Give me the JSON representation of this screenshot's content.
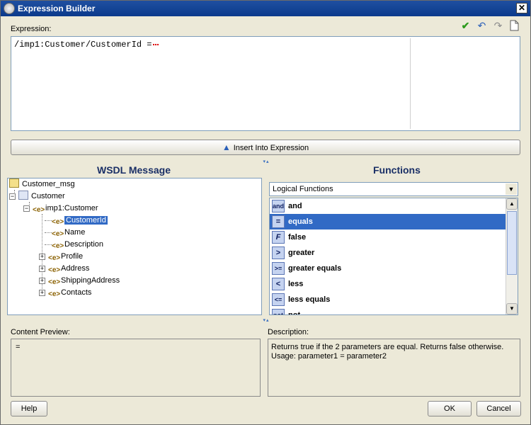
{
  "window": {
    "title": "Expression Builder",
    "close_label": "✕"
  },
  "expression": {
    "label": "Expression:",
    "value": "/imp1:Customer/CustomerId ="
  },
  "toolbar": {
    "icons": [
      "checkmark-icon",
      "undo-icon",
      "redo-icon",
      "new-document-icon"
    ]
  },
  "insert_button": {
    "label": "Insert Into Expression"
  },
  "wsdl": {
    "title": "WSDL Message",
    "tree": [
      {
        "label": "Customer_msg"
      },
      {
        "label": "Customer"
      },
      {
        "label": "imp1:Customer"
      },
      {
        "label": "CustomerId",
        "selected": true
      },
      {
        "label": "Name"
      },
      {
        "label": "Description"
      },
      {
        "label": "Profile"
      },
      {
        "label": "Address"
      },
      {
        "label": "ShippingAddress"
      },
      {
        "label": "Contacts"
      }
    ]
  },
  "functions": {
    "title": "Functions",
    "category": "Logical Functions",
    "items": [
      {
        "icon": "and",
        "label": "and"
      },
      {
        "icon": "=",
        "label": "equals",
        "selected": true
      },
      {
        "icon": "F",
        "label": "false"
      },
      {
        "icon": ">",
        "label": "greater"
      },
      {
        "icon": ">=",
        "label": "greater equals"
      },
      {
        "icon": "<",
        "label": "less"
      },
      {
        "icon": "<=",
        "label": "less equals"
      },
      {
        "icon": "not",
        "label": "not"
      }
    ]
  },
  "content_preview": {
    "label": "Content Preview:",
    "value": "="
  },
  "description": {
    "label": "Description:",
    "line1": "Returns true if the 2 parameters are equal. Returns false otherwise.",
    "line2": "Usage: parameter1 = parameter2"
  },
  "buttons": {
    "help": "Help",
    "ok": "OK",
    "cancel": "Cancel"
  },
  "colors": {
    "selection": "#316ac5",
    "title_bar": "#0b3a8c",
    "section_title": "#1a2f66"
  }
}
